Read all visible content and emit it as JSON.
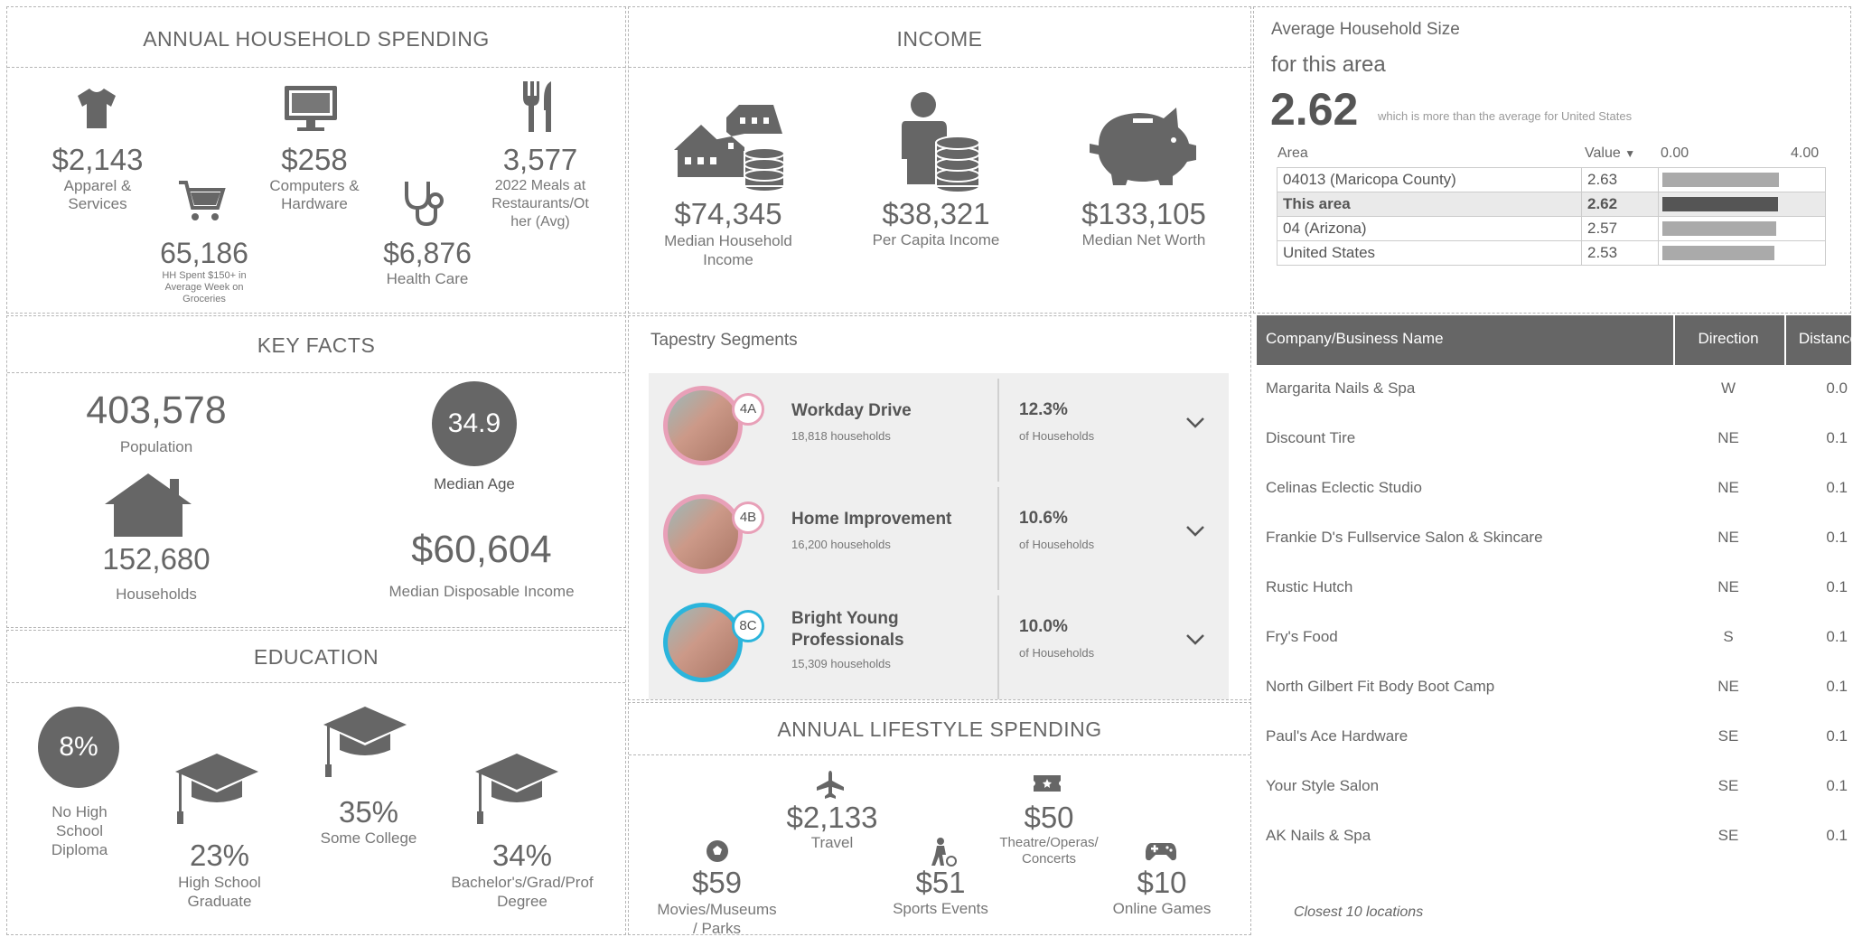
{
  "spending": {
    "title": "ANNUAL HOUSEHOLD SPENDING",
    "apparel": {
      "value": "$2,143",
      "label1": "Apparel &",
      "label2": "Services",
      "icon": "shirt-icon"
    },
    "computers": {
      "value": "$258",
      "label1": "Computers &",
      "label2": "Hardware",
      "icon": "monitor-icon"
    },
    "meals": {
      "value": "3,577",
      "label1": "2022 Meals at",
      "label2": "Restaurants/Ot",
      "label3": "her (Avg)",
      "icon": "fork-knife-icon"
    },
    "groceries": {
      "value": "65,186",
      "label1": "HH Spent $150+ in",
      "label2": "Average Week on",
      "label3": "Groceries",
      "icon": "cart-icon"
    },
    "health": {
      "value": "$6,876",
      "label": "Health Care",
      "icon": "stethoscope-icon"
    }
  },
  "income": {
    "title": "INCOME",
    "household": {
      "value": "$74,345",
      "label1": "Median Household",
      "label2": "Income",
      "icon": "house-coins-icon"
    },
    "per_capita": {
      "value": "$38,321",
      "label": "Per Capita Income",
      "icon": "person-coins-icon"
    },
    "net_worth": {
      "value": "$133,105",
      "label": "Median Net Worth",
      "icon": "piggy-bank-icon"
    }
  },
  "avg_household": {
    "title": "Average Household Size",
    "subtitle": "for this area",
    "value": "2.62",
    "note": "which is more than the average for United States",
    "col_area": "Area",
    "col_value": "Value",
    "sort_glyph": "▼",
    "axis_min": "0.00",
    "axis_max": "4.00",
    "rows": [
      {
        "area": "04013 (Maricopa County)",
        "value": "2.63",
        "bar": 0.6575
      },
      {
        "area": "This area",
        "value": "2.62",
        "bar": 0.655
      },
      {
        "area": "04 (Arizona)",
        "value": "2.57",
        "bar": 0.6425
      },
      {
        "area": "United States",
        "value": "2.53",
        "bar": 0.6325
      }
    ]
  },
  "key_facts": {
    "title": "KEY FACTS",
    "population": {
      "value": "403,578",
      "label": "Population"
    },
    "median_age": {
      "value": "34.9",
      "label": "Median Age"
    },
    "households": {
      "value": "152,680",
      "label": "Households",
      "icon": "house-icon"
    },
    "disposable": {
      "value": "$60,604",
      "label": "Median Disposable Income"
    }
  },
  "tapestry": {
    "title": "Tapestry Segments",
    "segments": [
      {
        "code": "4A",
        "name1": "Workday Drive",
        "name2": "",
        "households": "18,818 households",
        "pct": "12.3%",
        "pct_label": "of Households",
        "ring": "#e8a0b8"
      },
      {
        "code": "4B",
        "name1": "Home Improvement",
        "name2": "",
        "households": "16,200 households",
        "pct": "10.6%",
        "pct_label": "of Households",
        "ring": "#e8a0b8"
      },
      {
        "code": "8C",
        "name1": "Bright Young",
        "name2": "Professionals",
        "households": "15,309 households",
        "pct": "10.0%",
        "pct_label": "of Households",
        "ring": "#2bb5dc"
      }
    ]
  },
  "education": {
    "title": "EDUCATION",
    "no_hs": {
      "value": "8%",
      "label1": "No High",
      "label2": "School",
      "label3": "Diploma"
    },
    "hs": {
      "value": "23%",
      "label1": "High School",
      "label2": "Graduate"
    },
    "some_college": {
      "value": "35%",
      "label": "Some College"
    },
    "bachelors": {
      "value": "34%",
      "label1": "Bachelor's/Grad/Prof",
      "label2": "Degree"
    }
  },
  "lifestyle": {
    "title": "ANNUAL LIFESTYLE SPENDING",
    "travel": {
      "value": "$2,133",
      "label": "Travel",
      "icon": "airplane-icon"
    },
    "theatre": {
      "value": "$50",
      "label1": "Theatre/Operas/",
      "label2": "Concerts",
      "icon": "ticket-icon"
    },
    "movies": {
      "value": "$59",
      "label1": "Movies/Museums",
      "label2": "/ Parks",
      "icon": "soccer-ball-icon"
    },
    "sports": {
      "value": "$51",
      "label": "Sports Events",
      "icon": "player-icon"
    },
    "games": {
      "value": "$10",
      "label": "Online Games",
      "icon": "gamepad-icon"
    }
  },
  "business": {
    "col_name": "Company/Business Name",
    "col_direction": "Direction",
    "col_distance": "Distance",
    "header_bg": "#666666",
    "rows": [
      {
        "name": "Margarita Nails & Spa",
        "direction": "W",
        "distance": "0.0"
      },
      {
        "name": "Discount Tire",
        "direction": "NE",
        "distance": "0.1"
      },
      {
        "name": "Celinas Eclectic Studio",
        "direction": "NE",
        "distance": "0.1"
      },
      {
        "name": "Frankie D's Fullservice Salon & Skincare",
        "direction": "NE",
        "distance": "0.1"
      },
      {
        "name": "Rustic Hutch",
        "direction": "NE",
        "distance": "0.1"
      },
      {
        "name": "Fry's Food",
        "direction": "S",
        "distance": "0.1"
      },
      {
        "name": "North Gilbert Fit Body Boot Camp",
        "direction": "NE",
        "distance": "0.1"
      },
      {
        "name": "Paul's Ace Hardware",
        "direction": "SE",
        "distance": "0.1"
      },
      {
        "name": "Your Style Salon",
        "direction": "SE",
        "distance": "0.1"
      },
      {
        "name": "AK Nails & Spa",
        "direction": "SE",
        "distance": "0.1"
      }
    ],
    "footer": "Closest 10 locations"
  }
}
